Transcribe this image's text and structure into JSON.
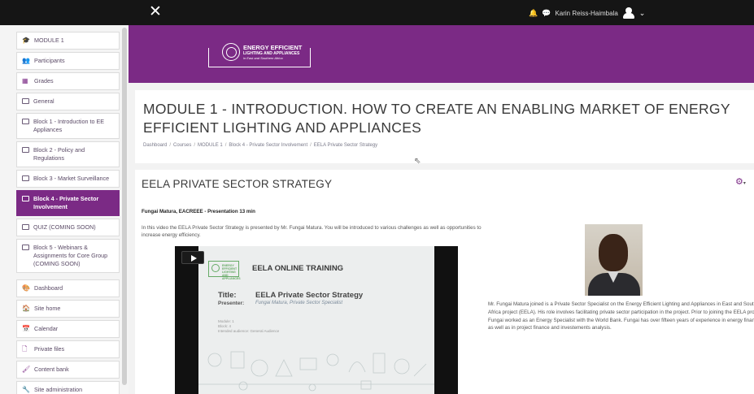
{
  "navbar": {
    "close_glyph": "✕",
    "bell_glyph": "🔔",
    "chat_glyph": "💬",
    "user_name": "Karin Reiss-Haimbala",
    "caret_glyph": "⌄"
  },
  "sidebar": {
    "items": [
      {
        "label": "MODULE 1",
        "icon": "graduation-cap-icon",
        "glyph": "🎓",
        "active": false
      },
      {
        "label": "Participants",
        "icon": "users-icon",
        "glyph": "👥",
        "active": false
      },
      {
        "label": "Grades",
        "icon": "table-icon",
        "glyph": "▦",
        "active": false
      },
      {
        "label": "General",
        "icon": "folder-icon",
        "glyph": "",
        "active": false
      },
      {
        "label": "Block 1 - Introduction to EE Appliances",
        "icon": "folder-icon",
        "glyph": "",
        "active": false
      },
      {
        "label": "Block 2 - Policy and Regulations",
        "icon": "folder-icon",
        "glyph": "",
        "active": false
      },
      {
        "label": "Block 3 - Market Surveillance",
        "icon": "folder-icon",
        "glyph": "",
        "active": false
      },
      {
        "label": "Block 4 - Private Sector Involvement",
        "icon": "folder-icon",
        "glyph": "",
        "active": true
      },
      {
        "label": "QUIZ (COMING SOON)",
        "icon": "folder-icon",
        "glyph": "",
        "active": false
      },
      {
        "label": "Block 5 - Webinars & Assignments for Core Group (COMING SOON)",
        "icon": "folder-icon",
        "glyph": "",
        "active": false
      },
      {
        "label": "Dashboard",
        "icon": "dashboard-icon",
        "glyph": "🎨",
        "active": false
      },
      {
        "label": "Site home",
        "icon": "home-icon",
        "glyph": "🏠",
        "active": false
      },
      {
        "label": "Calendar",
        "icon": "calendar-icon",
        "glyph": "📅",
        "active": false
      },
      {
        "label": "Private files",
        "icon": "file-icon",
        "glyph": "🗋",
        "active": false
      },
      {
        "label": "Content bank",
        "icon": "paint-brush-icon",
        "glyph": "🖌",
        "active": false
      },
      {
        "label": "Site administration",
        "icon": "wrench-icon",
        "glyph": "🔧",
        "active": false
      }
    ]
  },
  "banner": {
    "logo_line1": "ENERGY EFFICIENT",
    "logo_line2": "LIGHTING AND APPLIANCES",
    "logo_line3": "in East and Southern Africa",
    "color": "#7b2a85"
  },
  "page": {
    "title": "MODULE 1 - INTRODUCTION. HOW TO CREATE AN ENABLING MARKET OF ENERGY EFFICIENT LIGHTING AND APPLIANCES",
    "breadcrumb": [
      "Dashboard",
      "Courses",
      "MODULE 1",
      "Block 4 - Private Sector Involvement",
      "EELA Private Sector Strategy"
    ],
    "breadcrumb_sep": "/"
  },
  "content": {
    "section_title": "EELA PRIVATE SECTOR STRATEGY",
    "presenter_line": "Fungai Matura, EACREEE - Presentation 13 min",
    "description": "In this video the EELA Private Sector Strategy is presented by Mr. Fungai Matura. You will be introduced to various challenges as well as opportunities to increase energy efficiency.",
    "bio": "Mr. Fungai Matura joined is a Private Sector Specialist on the Energy Efficient Lighting and Appliances in East and Southern Africa project (EELA). His role involves facilitating private sector participation in the project. Prior to joining the EELA project Fungai worked as an Energy Specialist with the World Bank. Fungai has over fifteen years of experience in energy financing as well as in project finance and investements analysis."
  },
  "video": {
    "slide_logo_text": "ENERGY EFFICIENT LIGHTING AND APPLIANCES",
    "slide_heading": "EELA ONLINE TRAINING",
    "title_label": "Title:",
    "title_value": "EELA Private Sector Strategy",
    "presenter_label": "Presenter:",
    "presenter_value": "Fungai Matura, Private Sector Specialist",
    "module_label": "Module: 1",
    "block_label": "Block: 4",
    "audience_label": "Intended audience: General Audience"
  }
}
